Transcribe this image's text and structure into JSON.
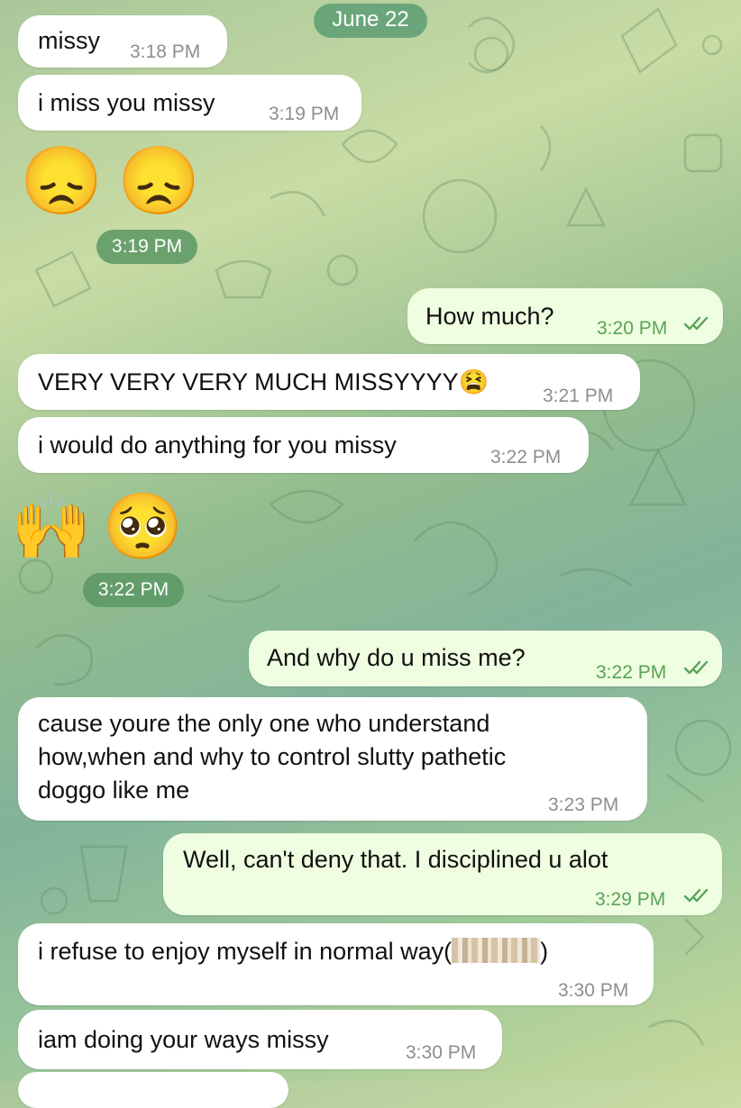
{
  "chat": {
    "date_label": "June 22",
    "messages": [
      {
        "text": "missy",
        "time": "3:18 PM"
      },
      {
        "text": "i miss you missy",
        "time": "3:19 PM"
      },
      {
        "emoji": "😞😞",
        "time": "3:19 PM"
      },
      {
        "text": "How much?",
        "time": "3:20 PM"
      },
      {
        "text": "VERY VERY VERY MUCH MISSYYYY",
        "emoji": "😫",
        "time": "3:21 PM"
      },
      {
        "text": "i would do anything for you missy",
        "time": "3:22 PM"
      },
      {
        "emoji": "🙌🥺",
        "time": "3:22 PM"
      },
      {
        "text": "And why do u miss me?",
        "time": "3:22 PM"
      },
      {
        "lines": [
          "cause youre the only one who understand",
          "how,when and why to control slutty pathetic",
          "doggo like me"
        ],
        "time": "3:23 PM"
      },
      {
        "text": "Well, can't deny that. I disciplined u alot",
        "time": "3:29 PM"
      },
      {
        "text_start": "i refuse to enjoy myself in normal way(",
        "text_end": ")",
        "time": "3:30 PM"
      },
      {
        "text": "iam doing your ways missy",
        "time": "3:30 PM"
      }
    ]
  },
  "colors": {
    "incoming": "#ffffff",
    "outgoing": "#effde0",
    "read_ticks": "#58a35a",
    "date_pill": "#6aa67a"
  }
}
